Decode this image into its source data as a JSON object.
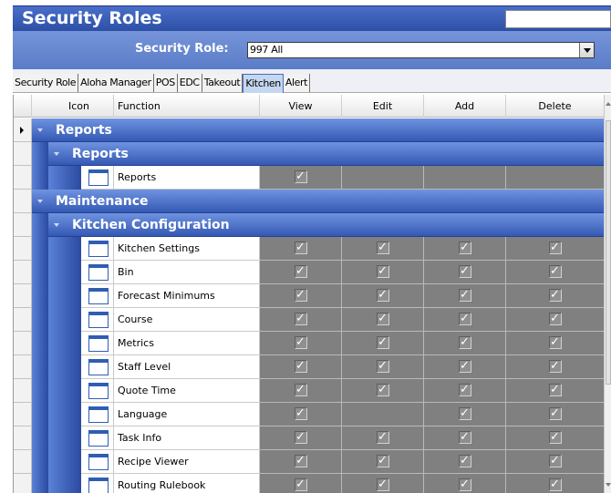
{
  "window": {
    "title": "Security Roles",
    "title_search_value": ""
  },
  "role_selector": {
    "label": "Security Role:",
    "selected": "997 All"
  },
  "tabs": [
    {
      "label": "Security Role",
      "active": false
    },
    {
      "label": "Aloha Manager",
      "active": false
    },
    {
      "label": "POS",
      "active": false
    },
    {
      "label": "EDC",
      "active": false
    },
    {
      "label": "Takeout",
      "active": false
    },
    {
      "label": "Kitchen",
      "active": true
    },
    {
      "label": "Alert",
      "active": false
    }
  ],
  "grid": {
    "columns": {
      "icon": "Icon",
      "function": "Function",
      "view": "View",
      "edit": "Edit",
      "add": "Add",
      "delete": "Delete"
    },
    "check_glyph": "✓",
    "groups": [
      {
        "level": 1,
        "label": "Reports"
      },
      {
        "level": 2,
        "label": "Reports"
      },
      {
        "level": 1,
        "label": "Maintenance"
      },
      {
        "level": 2,
        "label": "Kitchen Configuration"
      }
    ],
    "rows": [
      {
        "function": "Reports",
        "view": true,
        "edit": false,
        "add": false,
        "delete": false
      },
      {
        "function": "Kitchen Settings",
        "view": true,
        "edit": true,
        "add": true,
        "delete": true
      },
      {
        "function": "Bin",
        "view": true,
        "edit": true,
        "add": true,
        "delete": true
      },
      {
        "function": "Forecast Minimums",
        "view": true,
        "edit": true,
        "add": true,
        "delete": true
      },
      {
        "function": "Course",
        "view": true,
        "edit": true,
        "add": true,
        "delete": true
      },
      {
        "function": "Metrics",
        "view": true,
        "edit": true,
        "add": true,
        "delete": true
      },
      {
        "function": "Staff Level",
        "view": true,
        "edit": true,
        "add": true,
        "delete": true
      },
      {
        "function": "Quote Time",
        "view": true,
        "edit": true,
        "add": true,
        "delete": true
      },
      {
        "function": "Language",
        "view": true,
        "edit": false,
        "add": true,
        "delete": true
      },
      {
        "function": "Task Info",
        "view": true,
        "edit": true,
        "add": true,
        "delete": true
      },
      {
        "function": "Recipe Viewer",
        "view": true,
        "edit": true,
        "add": true,
        "delete": true
      },
      {
        "function": "Routing Rulebook",
        "view": true,
        "edit": true,
        "add": true,
        "delete": true
      }
    ]
  }
}
